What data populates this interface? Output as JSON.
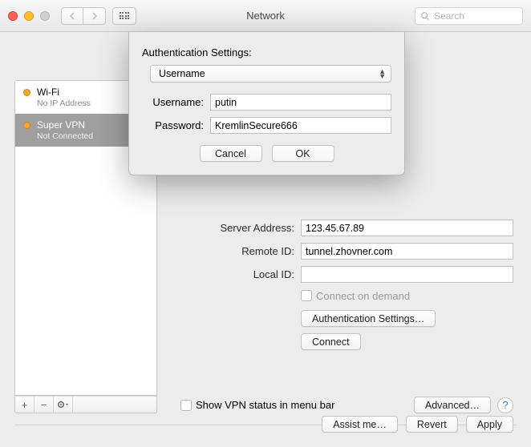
{
  "window": {
    "title": "Network",
    "search_placeholder": "Search"
  },
  "sidebar": {
    "items": [
      {
        "name": "Wi-Fi",
        "status": "No IP Address"
      },
      {
        "name": "Super VPN",
        "status": "Not Connected"
      }
    ]
  },
  "form": {
    "server_address_label": "Server Address:",
    "server_address": "123.45.67.89",
    "remote_id_label": "Remote ID:",
    "remote_id": "tunnel.zhovner.com",
    "local_id_label": "Local ID:",
    "local_id": "",
    "connect_on_demand": "Connect on demand",
    "auth_settings_btn": "Authentication Settings…",
    "connect_btn": "Connect",
    "show_status": "Show VPN status in menu bar",
    "advanced_btn": "Advanced…"
  },
  "footer": {
    "assist": "Assist me…",
    "revert": "Revert",
    "apply": "Apply"
  },
  "sheet": {
    "title": "Authentication Settings:",
    "method": "Username",
    "username_label": "Username:",
    "username": "putin",
    "password_label": "Password:",
    "password": "KremlinSecure666",
    "cancel": "Cancel",
    "ok": "OK"
  }
}
